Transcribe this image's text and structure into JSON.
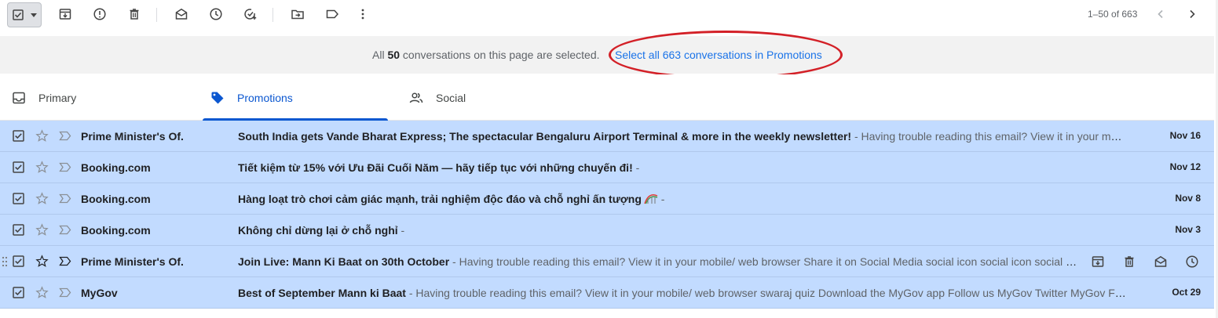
{
  "toolbar": {
    "select_checked": true,
    "actions": [
      {
        "icon": "archive-icon"
      },
      {
        "icon": "report-spam-icon"
      },
      {
        "icon": "delete-icon"
      },
      {
        "icon": "mark-read-icon"
      },
      {
        "icon": "snooze-icon"
      },
      {
        "icon": "add-to-tasks-icon"
      },
      {
        "icon": "move-to-icon"
      },
      {
        "icon": "label-icon"
      },
      {
        "icon": "more-icon"
      }
    ],
    "pagination": "1–50 of 663"
  },
  "banner": {
    "prefix": "All ",
    "count": "50",
    "suffix": " conversations on this page are selected.",
    "link": "Select all 663 conversations in Promotions",
    "highlight_color": "#d32027"
  },
  "tabs": [
    {
      "label": "Primary",
      "icon": "inbox-icon",
      "active": false
    },
    {
      "label": "Promotions",
      "icon": "tag-icon",
      "active": true
    },
    {
      "label": "Social",
      "icon": "people-icon",
      "active": false
    }
  ],
  "colors": {
    "accent": "#0b57d0",
    "selected_row": "#c2dbff",
    "link": "#1a73e8"
  },
  "emails": [
    {
      "sender": "Prime Minister's Of.",
      "subject": "South India gets Vande Bharat Express; The spectacular Bengaluru Airport Terminal & more in the weekly newsletter!",
      "snippet": " - Having trouble reading this email? View it in your mobile/ web browser",
      "date": "Nov 16",
      "selected": true,
      "hovered": false
    },
    {
      "sender": "Booking.com",
      "subject": "Tiết kiệm từ 15% với Ưu Đãi Cuối Năm — hãy tiếp tục với những chuyến đi!",
      "snippet": " -",
      "date": "Nov 12",
      "selected": true,
      "hovered": false
    },
    {
      "sender": "Booking.com",
      "subject": "Hàng loạt trò chơi cảm giác mạnh, trải nghiệm độc đáo và chỗ nghỉ ấn tượng",
      "snippet": " -",
      "date": "Nov 8",
      "selected": true,
      "hovered": false,
      "emoji": "rainbow-icon"
    },
    {
      "sender": "Booking.com",
      "subject": "Không chỉ dừng lại ở chỗ nghỉ",
      "snippet": " -",
      "date": "Nov 3",
      "selected": true,
      "hovered": false
    },
    {
      "sender": "Prime Minister's Of.",
      "subject": "Join Live: Mann Ki Baat on 30th October",
      "snippet": " - Having trouble reading this email? View it in your mobile/ web browser Share it on Social Media social icon social icon social icon",
      "date": "",
      "selected": true,
      "hovered": true
    },
    {
      "sender": "MyGov",
      "subject": "Best of September Mann ki Baat",
      "snippet": " - Having trouble reading this email? View it in your mobile/ web browser swaraj quiz Download the MyGov app Follow us MyGov Twitter MyGov Facebook",
      "date": "Oct 29",
      "selected": true,
      "hovered": false
    }
  ]
}
